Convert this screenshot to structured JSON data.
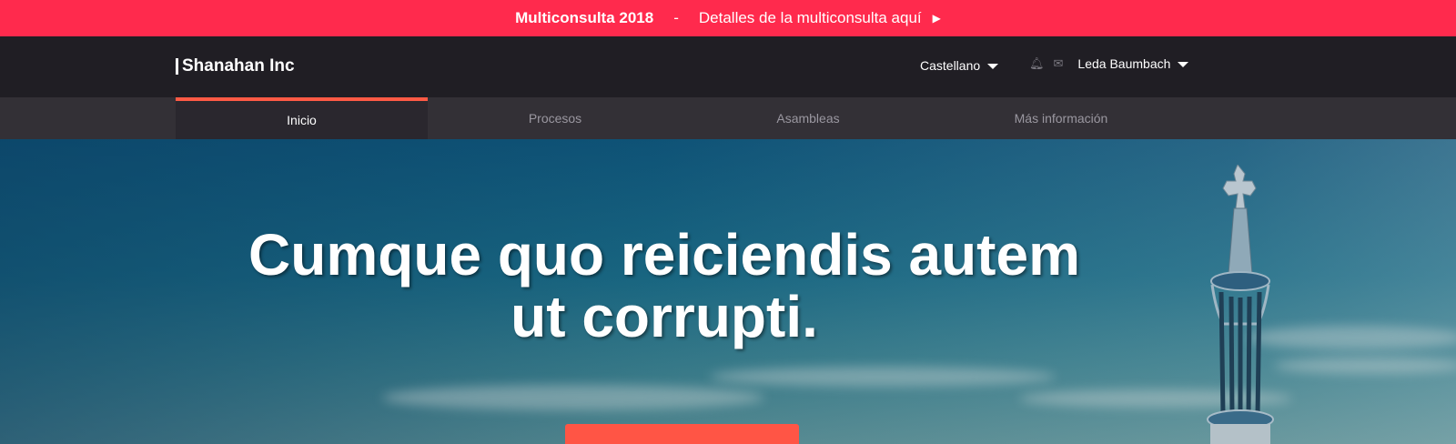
{
  "announcement": {
    "title": "Multiconsulta 2018",
    "separator": "-",
    "details": "Detalles de la multiconsulta aquí",
    "arrow_icon": "play-arrow-icon"
  },
  "header": {
    "brand": "Shanahan Inc",
    "language": "Castellano",
    "user_name": "Leda Baumbach",
    "icons": [
      "bell-icon",
      "mail-icon"
    ]
  },
  "nav": {
    "tabs": [
      {
        "label": "Inicio",
        "active": true
      },
      {
        "label": "Procesos",
        "active": false
      },
      {
        "label": "Asambleas",
        "active": false
      },
      {
        "label": "Más información",
        "active": false
      }
    ]
  },
  "hero": {
    "title": "Cumque quo reiciendis autem ut corrupti."
  },
  "colors": {
    "accent": "#ff2a4d",
    "cta": "#ff5545",
    "header_bg": "#201e24",
    "nav_bg": "#333036"
  }
}
